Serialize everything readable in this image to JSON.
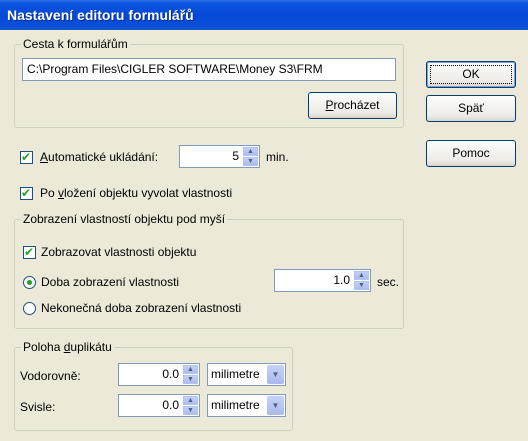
{
  "window": {
    "title": "Nastavení editoru formulářů"
  },
  "path_group": {
    "legend": "Cesta k formulářům",
    "path": "C:\\Program Files\\CIGLER SOFTWARE\\Money S3\\FRM",
    "browse_accel": "P",
    "browse_rest": "rocházet"
  },
  "buttons": {
    "ok": "OK",
    "back": "Späť",
    "help": "Pomoc"
  },
  "autosave": {
    "checked": true,
    "label_accel": "A",
    "label_rest": "utomatické ukládání:",
    "value": "5",
    "unit": "min."
  },
  "after_insert": {
    "checked": true,
    "label_pre": "Po ",
    "label_accel": "v",
    "label_rest": "ložení objektu vyvolat vlastnosti"
  },
  "hover_group": {
    "legend": "Zobrazení vlastností objektu pod myší",
    "show_props": {
      "checked": true,
      "label": "Zobrazovat vlastnosti objektu"
    },
    "duration": {
      "selected": true,
      "label": "Doba zobrazení vlastnosti",
      "value": "1.0",
      "unit": "sec."
    },
    "infinite": {
      "selected": false,
      "label": "Nekonečná doba zobrazení vlastnosti"
    }
  },
  "dup_group": {
    "legend_pre": "Poloha ",
    "legend_accel": "d",
    "legend_rest": "uplikátu",
    "horizontal": {
      "label": "Vodorovně:",
      "value": "0.0",
      "unit": "milimetre"
    },
    "vertical": {
      "label": "Svisle:",
      "value": "0.0",
      "unit": "milimetre"
    }
  }
}
